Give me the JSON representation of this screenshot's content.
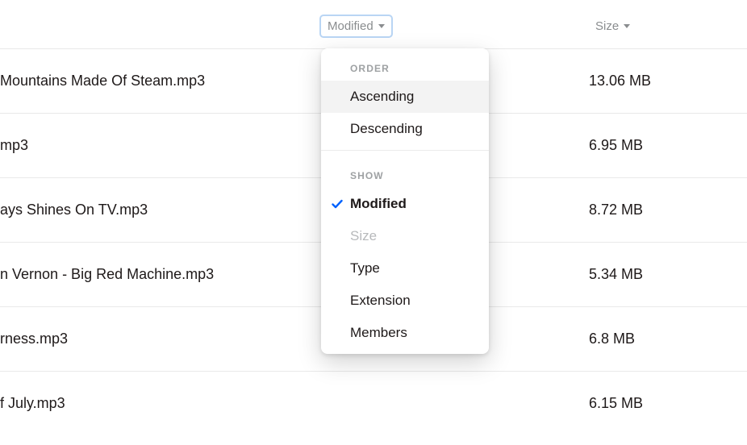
{
  "columns": {
    "modified": {
      "label": "Modified"
    },
    "size": {
      "label": "Size"
    }
  },
  "rows": [
    {
      "name": "Mountains Made Of Steam.mp3",
      "size": "13.06 MB",
      "modified": ""
    },
    {
      "name": "mp3",
      "size": "6.95 MB",
      "modified": ""
    },
    {
      "name": "ays Shines On TV.mp3",
      "size": "8.72 MB",
      "modified": ""
    },
    {
      "name": "n Vernon - Big Red Machine.mp3",
      "size": "5.34 MB",
      "modified": ""
    },
    {
      "name": "rness.mp3",
      "size": "6.8 MB",
      "modified": ""
    },
    {
      "name": "f July.mp3",
      "size": "6.15 MB",
      "modified": ""
    }
  ],
  "dropdown": {
    "section_order": "ORDER",
    "ascending": "Ascending",
    "descending": "Descending",
    "section_show": "SHOW",
    "modified": "Modified",
    "size": "Size",
    "type": "Type",
    "extension": "Extension",
    "members": "Members"
  }
}
